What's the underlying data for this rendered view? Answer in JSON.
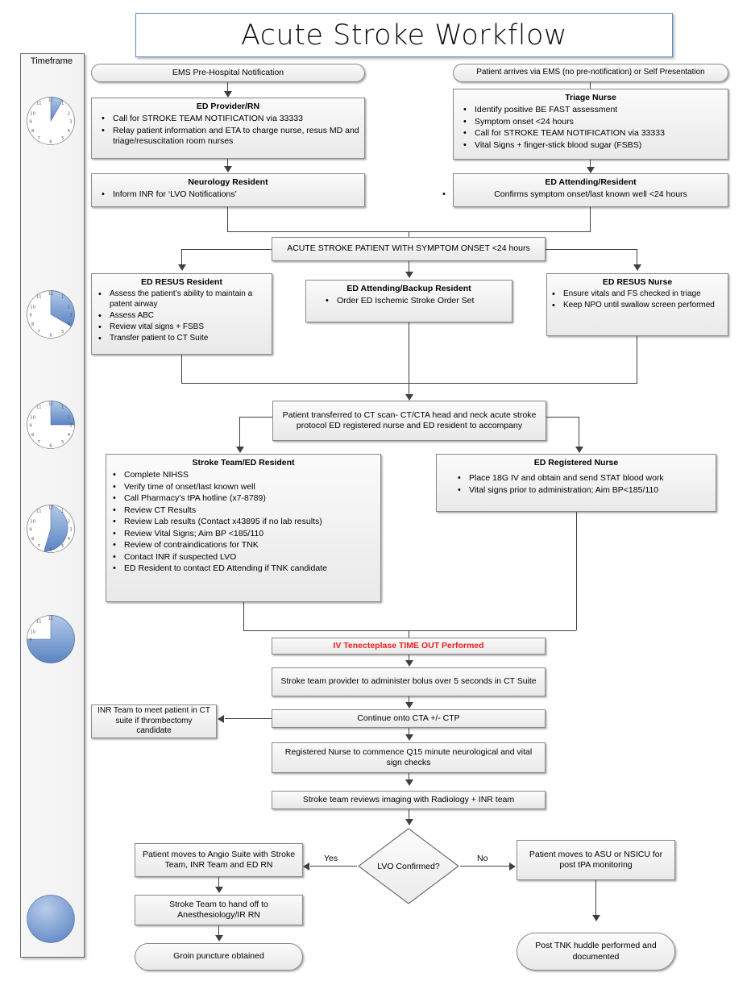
{
  "title": "Acute Stroke Workflow",
  "timeframe": {
    "label": "Timeframe",
    "clocks": [
      {
        "name": "clock-5-min",
        "minutes": 5
      },
      {
        "name": "clock-10-min",
        "minutes": 10
      },
      {
        "name": "clock-15-min",
        "minutes": 15
      },
      {
        "name": "clock-25-min",
        "minutes": 25
      },
      {
        "name": "clock-45-min",
        "minutes": 45
      },
      {
        "name": "clock-60-min",
        "minutes": 60
      }
    ]
  },
  "nodes": {
    "ems_notification": {
      "label": "EMS Pre-Hospital Notification"
    },
    "patient_arrives": {
      "label": "Patient arrives via EMS (no pre-notification) or Self Presentation"
    },
    "ed_provider_rn": {
      "title": "ED Provider/RN",
      "items": [
        "Call for STROKE TEAM NOTIFICATION via 33333",
        "Relay patient information and ETA to charge nurse, resus MD and triage/resuscitation room nurses"
      ]
    },
    "triage_nurse": {
      "title": "Triage Nurse",
      "items": [
        "Identify positive BE FAST assessment",
        "Symptom onset <24 hours",
        "Call for STROKE TEAM NOTIFICATION via 33333",
        "Vital Signs + finger-stick blood sugar (FSBS)"
      ]
    },
    "neurology_resident": {
      "title": "Neurology Resident",
      "items": [
        "Inform INR for ‘LVO Notifications’"
      ]
    },
    "ed_attending_resident": {
      "title": "ED Attending/Resident",
      "items": [
        "Confirms symptom onset/last known well <24 hours"
      ]
    },
    "acute_stroke_patient": {
      "label": "ACUTE STROKE PATIENT WITH SYMPTOM ONSET <24 hours"
    },
    "ed_resus_resident": {
      "title": "ED RESUS Resident",
      "items": [
        "Assess the patient’s ability to maintain a patent airway",
        "Assess ABC",
        "Review vital signs + FSBS",
        "Transfer patient to CT Suite"
      ]
    },
    "ed_attending_backup": {
      "title": "ED Attending/Backup Resident",
      "items": [
        "Order ED Ischemic Stroke Order Set"
      ]
    },
    "ed_resus_nurse": {
      "title": "ED RESUS Nurse",
      "items": [
        "Ensure vitals and FS checked in triage",
        "Keep NPO until swallow screen performed"
      ]
    },
    "patient_transferred_ct": {
      "label": "Patient transferred to CT scan- CT/CTA head and neck acute stroke protocol ED registered nurse and ED resident to accompany"
    },
    "stroke_team_ed_resident": {
      "title": "Stroke Team/ED Resident",
      "items": [
        "Complete NIHSS",
        "Verify time of onset/last known well",
        "Call Pharmacy’s tPA hotline (x7-8789)",
        "Review CT Results",
        "Review Lab results (Contact x43895 if no lab results)",
        "Review Vital Signs; Aim BP <185/110",
        "Review of contraindications for TNK",
        "Contact INR if suspected LVO",
        "ED Resident to contact ED Attending if TNK candidate"
      ]
    },
    "ed_registered_nurse": {
      "title": "ED Registered Nurse",
      "items": [
        "Place 18G IV and obtain and send STAT blood work",
        "Vital signs prior to administration; Aim BP<185/110"
      ]
    },
    "time_out": {
      "label": "IV Tenecteplase TIME OUT Performed",
      "color": "#ee1c1c"
    },
    "administer_bolus": {
      "label": "Stroke team provider to administer bolus over 5 seconds in CT Suite"
    },
    "continue_cta": {
      "label": "Continue onto CTA +/- CTP"
    },
    "inr_team_meet": {
      "label": "INR Team to meet patient in CT suite if thrombectomy candidate"
    },
    "q15_checks": {
      "label": "Registered Nurse to commence Q15 minute neurological and vital sign checks"
    },
    "reviews_imaging": {
      "label": "Stroke team reviews imaging with Radiology + INR team"
    },
    "lvo_confirmed": {
      "label": "LVO Confirmed?"
    },
    "angio_suite": {
      "label": "Patient moves to Angio Suite with Stroke Team, INR Team and ED RN"
    },
    "asu_nsicu": {
      "label": "Patient moves to ASU or NSICU for post tPA monitoring"
    },
    "hand_off": {
      "label": "Stroke Team to hand off to Anesthesiology/IR RN"
    },
    "post_tnk_huddle": {
      "label": "Post TNK huddle performed and documented"
    },
    "groin_puncture": {
      "label": "Groin puncture obtained"
    }
  },
  "edges": {
    "yes_label": "Yes",
    "no_label": "No"
  },
  "colors": {
    "accent_blue": "#6b93d0",
    "alert_red": "#ee1c1c",
    "node_border": "#8a8a8a",
    "connector": "#404040"
  }
}
